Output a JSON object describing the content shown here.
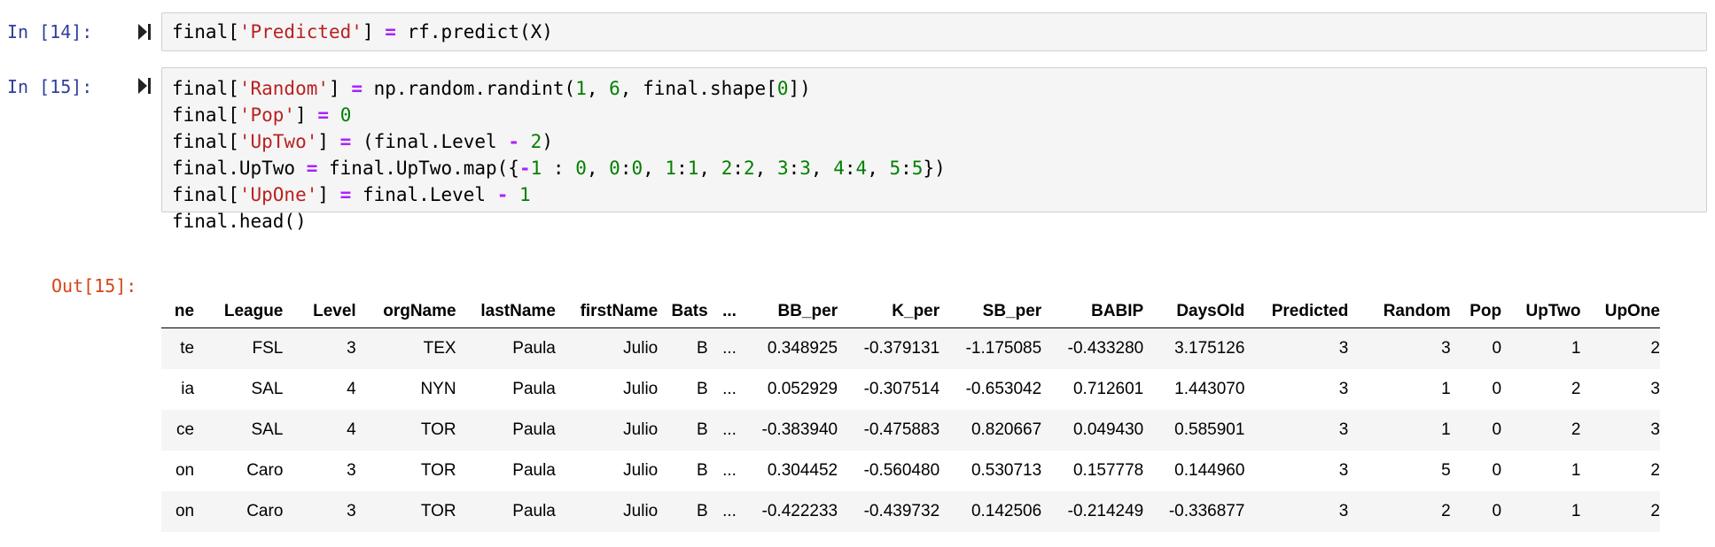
{
  "cells": [
    {
      "prompt": "In [14]:",
      "code_lines": [
        [
          {
            "t": "final["
          },
          {
            "t": "'Predicted'",
            "c": "s"
          },
          {
            "t": "] "
          },
          {
            "t": "=",
            "c": "o"
          },
          {
            "t": " rf.predict(X)"
          }
        ]
      ]
    },
    {
      "prompt": "In [15]:",
      "code_lines": [
        [
          {
            "t": "final["
          },
          {
            "t": "'Random'",
            "c": "s"
          },
          {
            "t": "] "
          },
          {
            "t": "=",
            "c": "o"
          },
          {
            "t": " np.random.randint("
          },
          {
            "t": "1",
            "c": "n"
          },
          {
            "t": ", "
          },
          {
            "t": "6",
            "c": "n"
          },
          {
            "t": ", final.shape["
          },
          {
            "t": "0",
            "c": "n"
          },
          {
            "t": "])"
          }
        ],
        [
          {
            "t": "final["
          },
          {
            "t": "'Pop'",
            "c": "s"
          },
          {
            "t": "] "
          },
          {
            "t": "=",
            "c": "o"
          },
          {
            "t": " "
          },
          {
            "t": "0",
            "c": "n"
          }
        ],
        [
          {
            "t": "final["
          },
          {
            "t": "'UpTwo'",
            "c": "s"
          },
          {
            "t": "] "
          },
          {
            "t": "=",
            "c": "o"
          },
          {
            "t": " (final.Level "
          },
          {
            "t": "-",
            "c": "o"
          },
          {
            "t": " "
          },
          {
            "t": "2",
            "c": "n"
          },
          {
            "t": ")"
          }
        ],
        [
          {
            "t": "final.UpTwo "
          },
          {
            "t": "=",
            "c": "o"
          },
          {
            "t": " final.UpTwo.map({"
          },
          {
            "t": "-",
            "c": "o"
          },
          {
            "t": "1",
            "c": "n"
          },
          {
            "t": " : "
          },
          {
            "t": "0",
            "c": "n"
          },
          {
            "t": ", "
          },
          {
            "t": "0",
            "c": "n"
          },
          {
            "t": ":"
          },
          {
            "t": "0",
            "c": "n"
          },
          {
            "t": ", "
          },
          {
            "t": "1",
            "c": "n"
          },
          {
            "t": ":"
          },
          {
            "t": "1",
            "c": "n"
          },
          {
            "t": ", "
          },
          {
            "t": "2",
            "c": "n"
          },
          {
            "t": ":"
          },
          {
            "t": "2",
            "c": "n"
          },
          {
            "t": ", "
          },
          {
            "t": "3",
            "c": "n"
          },
          {
            "t": ":"
          },
          {
            "t": "3",
            "c": "n"
          },
          {
            "t": ", "
          },
          {
            "t": "4",
            "c": "n"
          },
          {
            "t": ":"
          },
          {
            "t": "4",
            "c": "n"
          },
          {
            "t": ", "
          },
          {
            "t": "5",
            "c": "n"
          },
          {
            "t": ":"
          },
          {
            "t": "5",
            "c": "n"
          },
          {
            "t": "})"
          }
        ],
        [
          {
            "t": "final["
          },
          {
            "t": "'UpOne'",
            "c": "s"
          },
          {
            "t": "] "
          },
          {
            "t": "=",
            "c": "o"
          },
          {
            "t": " final.Level "
          },
          {
            "t": "-",
            "c": "o"
          },
          {
            "t": " "
          },
          {
            "t": "1",
            "c": "n"
          }
        ],
        [
          {
            "t": "final.head()"
          }
        ]
      ]
    }
  ],
  "output": {
    "prompt": "Out[15]:",
    "columns": [
      "ne",
      "League",
      "Level",
      "orgName",
      "lastName",
      "firstName",
      "Bats",
      "...",
      "BB_per",
      "K_per",
      "SB_per",
      "BABIP",
      "DaysOld",
      "Predicted",
      "Random",
      "Pop",
      "UpTwo",
      "UpOne"
    ],
    "rows": [
      [
        "te",
        "FSL",
        "3",
        "TEX",
        "Paula",
        "Julio",
        "B",
        "...",
        "0.348925",
        "-0.379131",
        "-1.175085",
        "-0.433280",
        "3.175126",
        "3",
        "3",
        "0",
        "1",
        "2"
      ],
      [
        "ia",
        "SAL",
        "4",
        "NYN",
        "Paula",
        "Julio",
        "B",
        "...",
        "0.052929",
        "-0.307514",
        "-0.653042",
        "0.712601",
        "1.443070",
        "3",
        "1",
        "0",
        "2",
        "3"
      ],
      [
        "ce",
        "SAL",
        "4",
        "TOR",
        "Paula",
        "Julio",
        "B",
        "...",
        "-0.383940",
        "-0.475883",
        "0.820667",
        "0.049430",
        "0.585901",
        "3",
        "1",
        "0",
        "2",
        "3"
      ],
      [
        "on",
        "Caro",
        "3",
        "TOR",
        "Paula",
        "Julio",
        "B",
        "...",
        "0.304452",
        "-0.560480",
        "0.530713",
        "0.157778",
        "0.144960",
        "3",
        "5",
        "0",
        "1",
        "2"
      ],
      [
        "on",
        "Caro",
        "3",
        "TOR",
        "Paula",
        "Julio",
        "B",
        "...",
        "-0.422233",
        "-0.439732",
        "0.142506",
        "-0.214249",
        "-0.336877",
        "3",
        "2",
        "0",
        "1",
        "2"
      ]
    ]
  }
}
